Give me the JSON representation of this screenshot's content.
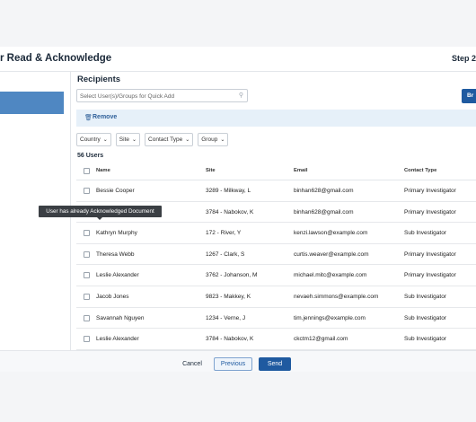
{
  "header": {
    "title": "r Read & Acknowledge",
    "step": "Step 2"
  },
  "recipients": {
    "title": "Recipients",
    "search_placeholder": "Select User(s)/Groups for Quick Add",
    "browse_label": "Br",
    "remove_label": "Remove",
    "filters": [
      {
        "label": "Country"
      },
      {
        "label": "Site"
      },
      {
        "label": "Contact Type"
      },
      {
        "label": "Group"
      }
    ],
    "count": "56 Users"
  },
  "table": {
    "headers": {
      "name": "Name",
      "site": "Site",
      "email": "Email",
      "contact_type": "Contact Type"
    },
    "rows": [
      {
        "name": "Bessie Cooper",
        "site": "3289 - Milkway, L",
        "email": "binhan628@gmail.com",
        "contact_type": "Primary Investigator"
      },
      {
        "name": "",
        "site": "3784 - Nabokov, K",
        "email": "binhan628@gmail.com",
        "contact_type": "Primary Investigator"
      },
      {
        "name": "Kathryn Murphy",
        "site": "172 - River, Y",
        "email": "kenzi.lawson@example.com",
        "contact_type": "Sub Investigator"
      },
      {
        "name": "Theresa Webb",
        "site": "1267 - Clark, S",
        "email": "curtis.weaver@example.com",
        "contact_type": "Primary Investigator"
      },
      {
        "name": "Leslie Alexander",
        "site": "3762 - Johanson, M",
        "email": "michael.mitc@example.com",
        "contact_type": "Primary Investigator"
      },
      {
        "name": "Jacob Jones",
        "site": "9823 - Makkey, K",
        "email": "nevaeh.simmons@example.com",
        "contact_type": "Sub Investigator"
      },
      {
        "name": "Savannah Nguyen",
        "site": "1234 - Verne, J",
        "email": "tim.jennings@example.com",
        "contact_type": "Sub Investigator"
      },
      {
        "name": "Leslie Alexander",
        "site": "3784 - Nabokov, K",
        "email": "ckctm12@gmail.com",
        "contact_type": "Sub Investigator"
      }
    ]
  },
  "tooltip": {
    "text": "User has already Acknowledged Document"
  },
  "footer": {
    "cancel_label": "Cancel",
    "previous_label": "Previous",
    "send_label": "Send"
  }
}
